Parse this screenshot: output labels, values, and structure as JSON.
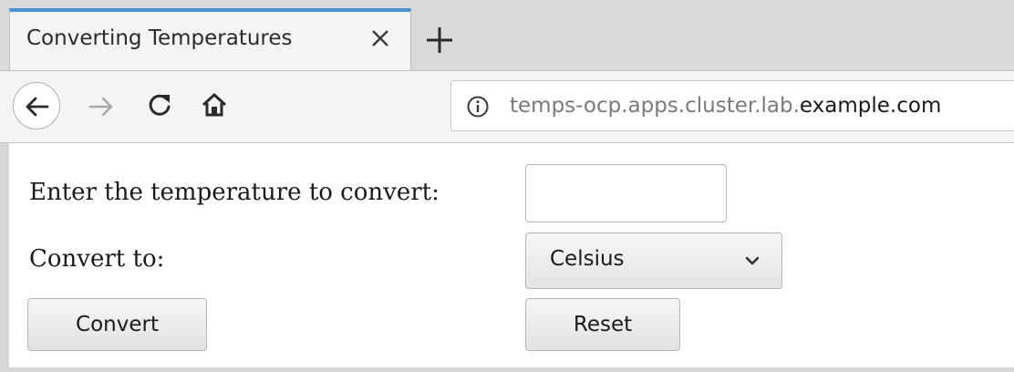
{
  "tabs": [
    {
      "title": "Converting Temperatures",
      "active": true
    }
  ],
  "toolbar": {
    "url_dim": "temps-ocp.apps.cluster.lab.",
    "url_domain": "example.com"
  },
  "form": {
    "temperature_label": "Enter the temperature to convert:",
    "temperature_value": "",
    "convert_to_label": "Convert to:",
    "unit_selected": "Celsius",
    "convert_button": "Convert",
    "reset_button": "Reset"
  },
  "colors": {
    "active_tab_accent": "#4a90d9"
  },
  "icons": {
    "tab_close": "close-icon",
    "new_tab": "plus-icon",
    "back": "arrow-left-icon",
    "forward": "arrow-right-icon",
    "reload": "reload-icon",
    "home": "home-icon",
    "site_info": "info-icon",
    "select_arrow": "chevron-down-icon"
  }
}
